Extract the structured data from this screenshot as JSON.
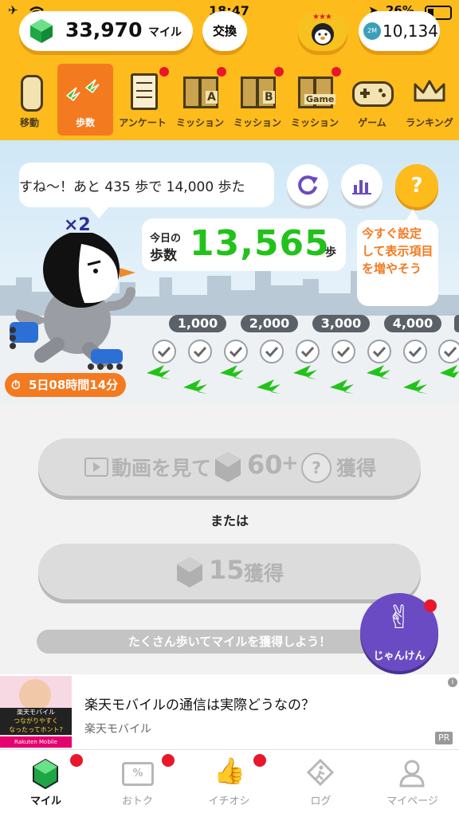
{
  "status_bar": {
    "time": "18:47",
    "battery": "26%"
  },
  "header": {
    "miles_value": "33,970",
    "miles_unit": "マイル",
    "exchange_label": "交換",
    "points_badge": "2M",
    "points_value": "10,134"
  },
  "nav": [
    {
      "label": "移動",
      "icon": "phone-cylinder-icon"
    },
    {
      "label": "歩数",
      "icon": "footprints-icon"
    },
    {
      "label": "アンケート",
      "icon": "clipboard-icon"
    },
    {
      "label": "ミッション",
      "icon": "gift-a-icon",
      "tag": "A"
    },
    {
      "label": "ミッション",
      "icon": "gift-b-icon",
      "tag": "B"
    },
    {
      "label": "ミッション",
      "icon": "gift-game-icon",
      "tag": "Game"
    },
    {
      "label": "ゲーム",
      "icon": "gamepad-icon"
    },
    {
      "label": "ランキング",
      "icon": "crown-icon"
    }
  ],
  "scene": {
    "speech_text": "すね〜！あと 435 歩で 14,000 歩た",
    "multiplier": "×2",
    "today_label_1": "今日の",
    "today_label_2": "歩数",
    "steps_value": "13,565",
    "steps_unit": "歩",
    "tip_text": "今すぐ設定して表示項目を増やそう",
    "timer_text": "5日08時間14分",
    "milestones": [
      "1,000",
      "2,000",
      "3,000",
      "4,000"
    ]
  },
  "actions": {
    "video_prefix": "動画を見て",
    "video_amount": "60",
    "plus": "+",
    "question": "?",
    "earn_label": "獲得",
    "or_label": "または",
    "amount_2": "15",
    "banner_text": "たくさん歩いてマイルを獲得しよう！",
    "janken_label": "じゃんけん"
  },
  "ad": {
    "title": "楽天モバイルの通信は実際どうなの？",
    "source": "楽天モバイル",
    "pr": "PR",
    "info": "i",
    "thumb_line1": "楽天モバイル",
    "thumb_line2": "つながりやすく",
    "thumb_line3": "なったってホント?",
    "thumb_brand": "Rakuten Mobile"
  },
  "tabs": [
    {
      "label": "マイル",
      "icon": "gem-icon",
      "active": true
    },
    {
      "label": "おトク",
      "icon": "coupon-icon"
    },
    {
      "label": "イチオシ",
      "icon": "thumbs-up-icon"
    },
    {
      "label": "ログ",
      "icon": "walker-icon"
    },
    {
      "label": "マイページ",
      "icon": "person-icon"
    }
  ],
  "colors": {
    "header": "#fdbb1c",
    "accent": "#f47a20",
    "steps_green": "#22c21a",
    "badge_red": "#e8172b"
  }
}
